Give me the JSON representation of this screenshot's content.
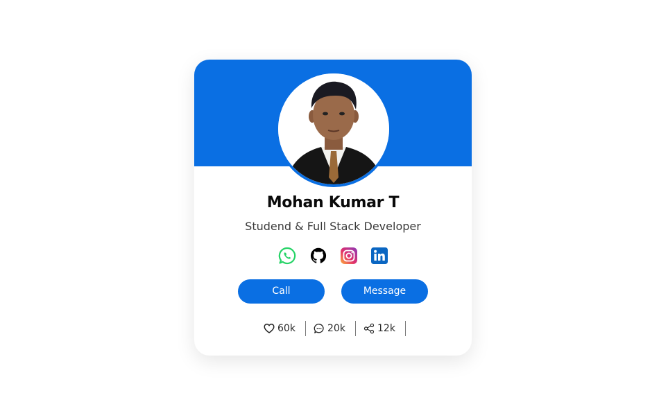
{
  "profile": {
    "name": "Mohan Kumar T",
    "role": "Studend & Full Stack Developer"
  },
  "social_links": [
    {
      "icon": "whatsapp-icon",
      "color": "#25d366"
    },
    {
      "icon": "github-icon",
      "color": "#000000"
    },
    {
      "icon": "instagram-icon",
      "color": "#e1306c"
    },
    {
      "icon": "linkedin-icon",
      "color": "#0a66c2"
    }
  ],
  "actions": {
    "call_label": "Call",
    "message_label": "Message"
  },
  "stats": {
    "likes": {
      "icon": "heart-icon",
      "value": "60k"
    },
    "comments": {
      "icon": "comment-icon",
      "value": "20k"
    },
    "shares": {
      "icon": "share-icon",
      "value": "12k"
    }
  },
  "colors": {
    "accent": "#0a6fe3",
    "background": "#ffffff"
  }
}
